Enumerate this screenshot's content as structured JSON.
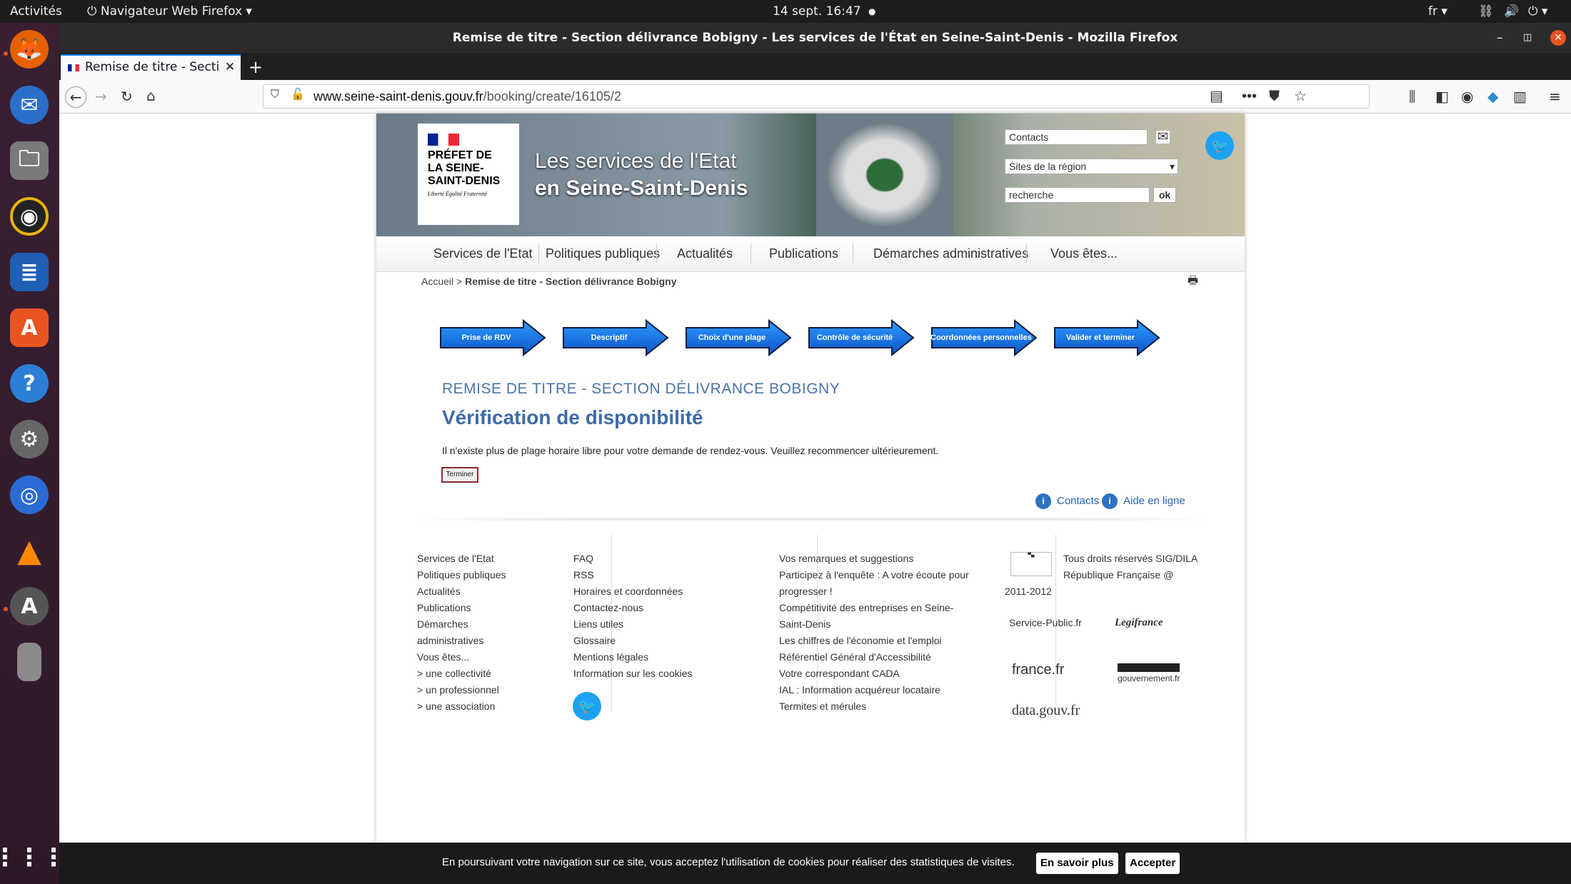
{
  "system": {
    "activities": "Activités",
    "app_name": "Navigateur Web Firefox",
    "datetime": "14 sept.  16:47",
    "lang": "fr"
  },
  "window": {
    "title": "Remise de titre - Section délivrance Bobigny - Les services de l'État en Seine-Saint-Denis - Mozilla Firefox"
  },
  "tab": {
    "label": "Remise de titre - Section délivrance Bobigny"
  },
  "url": {
    "domain": "www.seine-saint-denis.gouv.fr",
    "path": "/booking/create/16105/2"
  },
  "header": {
    "logo_text": "PRÉFET DE LA SEINE-SAINT-DENIS",
    "logo_motto": "Liberté Égalité Fraternité",
    "title_line1": "Les services de l'Etat",
    "title_line2": "en Seine-Saint-Denis",
    "contacts_field": "Contacts",
    "region_select": "Sites de la région",
    "search_field": "recherche",
    "ok_label": "ok"
  },
  "nav": [
    "Services de l'Etat",
    "Politiques publiques",
    "Actualités",
    "Publications",
    "Démarches administratives",
    "Vous êtes..."
  ],
  "breadcrumb": {
    "home": "Accueil",
    "sep": " > ",
    "current": "Remise de titre - Section délivrance Bobigny"
  },
  "steps": [
    "Prise de RDV",
    "Descriptif",
    "Choix d'une plage",
    "Contrôle de sécurité",
    "Coordonnées personnelles",
    "Valider et terminer"
  ],
  "content": {
    "section_title": "REMISE DE TITRE - SECTION DÉLIVRANCE BOBIGNY",
    "heading": "Vérification de disponibilité",
    "message": "Il n'existe plus de plage horaire libre pour votre demande de rendez-vous. Veuillez recommencer ultérieurement.",
    "button": "Terminer",
    "contacts_link": "Contacts",
    "help_link": "Aide en ligne"
  },
  "footer": {
    "col1": [
      "Services de l'Etat",
      "Politiques publiques",
      "Actualités",
      "Publications",
      "Démarches",
      "administratives",
      "Vous êtes...",
      "> une collectivité",
      "> un professionnel",
      "> une association"
    ],
    "col2": [
      "FAQ",
      "RSS",
      "Horaires et coordonnées",
      "Contactez-nous",
      "Liens utiles",
      "Glossaire",
      "Mentions légales",
      "Information sur les cookies"
    ],
    "col3": [
      "Vos remarques et suggestions",
      "Participez à l'enquête : A votre écoute pour",
      "progresser !",
      "Compétitivité des entreprises en Seine-",
      "Saint-Denis",
      "Les chiffres de l'économie et l'emploi",
      "Référentiel Général d'Accessibilité",
      "Votre correspondant CADA",
      "IAL : Information acquéreur locataire",
      "Termites et mérules"
    ],
    "rights": [
      "Tous droits réservés SIG/DILA",
      "République Française @",
      "2011-2012"
    ],
    "partners": [
      "Service-Public.fr",
      "Legifrance",
      "france.fr",
      "gouvernement.fr",
      "data.gouv.fr"
    ]
  },
  "cookie": {
    "text": "En poursuivant votre navigation sur ce site, vous acceptez l'utilisation de cookies pour réaliser des statistiques de visites.",
    "more": "En savoir plus",
    "accept": "Accepter"
  }
}
